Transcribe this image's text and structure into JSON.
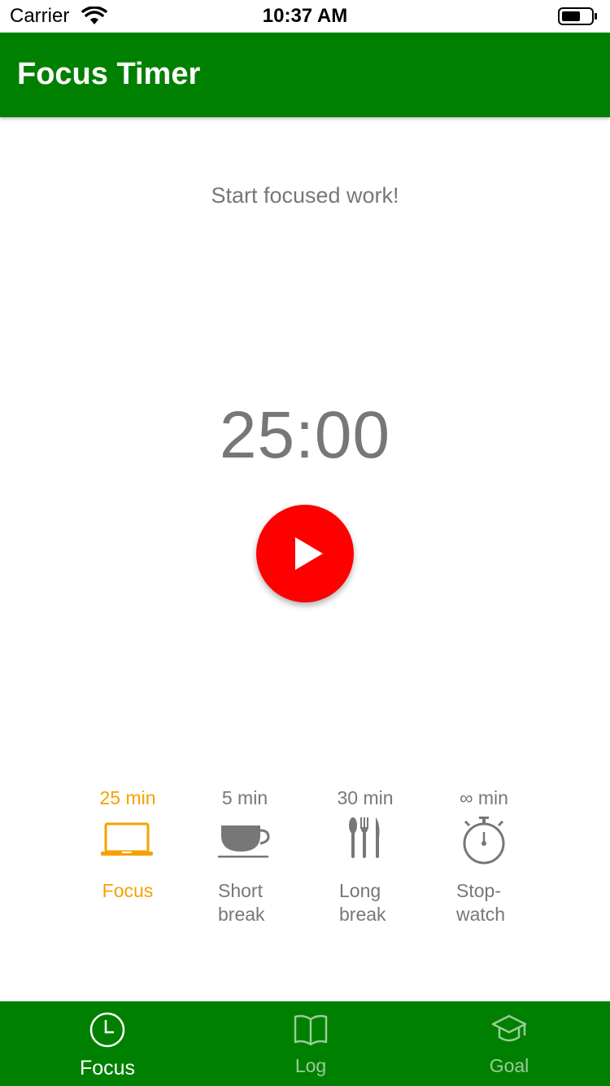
{
  "status_bar": {
    "carrier": "Carrier",
    "time": "10:37 AM",
    "icons": [
      "wifi-icon",
      "battery-icon"
    ]
  },
  "app_bar": {
    "title": "Focus Timer"
  },
  "main": {
    "prompt": "Start focused work!",
    "timer": "25:00",
    "play_icon": "play-icon"
  },
  "modes": [
    {
      "duration": "25 min",
      "label_1": "Focus",
      "label_2": "",
      "icon": "laptop-icon",
      "active": true
    },
    {
      "duration": "5 min",
      "label_1": "Short",
      "label_2": "break",
      "icon": "coffee-cup-icon",
      "active": false
    },
    {
      "duration": "30 min",
      "label_1": "Long",
      "label_2": "break",
      "icon": "utensils-icon",
      "active": false
    },
    {
      "duration": "∞ min",
      "label_1": "Stop-",
      "label_2": "watch",
      "icon": "stopwatch-icon",
      "active": false
    }
  ],
  "tabs": [
    {
      "label": "Focus",
      "icon": "clock-icon",
      "active": true
    },
    {
      "label": "Log",
      "icon": "book-icon",
      "active": false
    },
    {
      "label": "Goal",
      "icon": "graduation-cap-icon",
      "active": false
    }
  ],
  "colors": {
    "primary_green": "#008000",
    "play_red": "#ff0000",
    "active_orange": "#f5a100",
    "text_gray": "#777777"
  }
}
